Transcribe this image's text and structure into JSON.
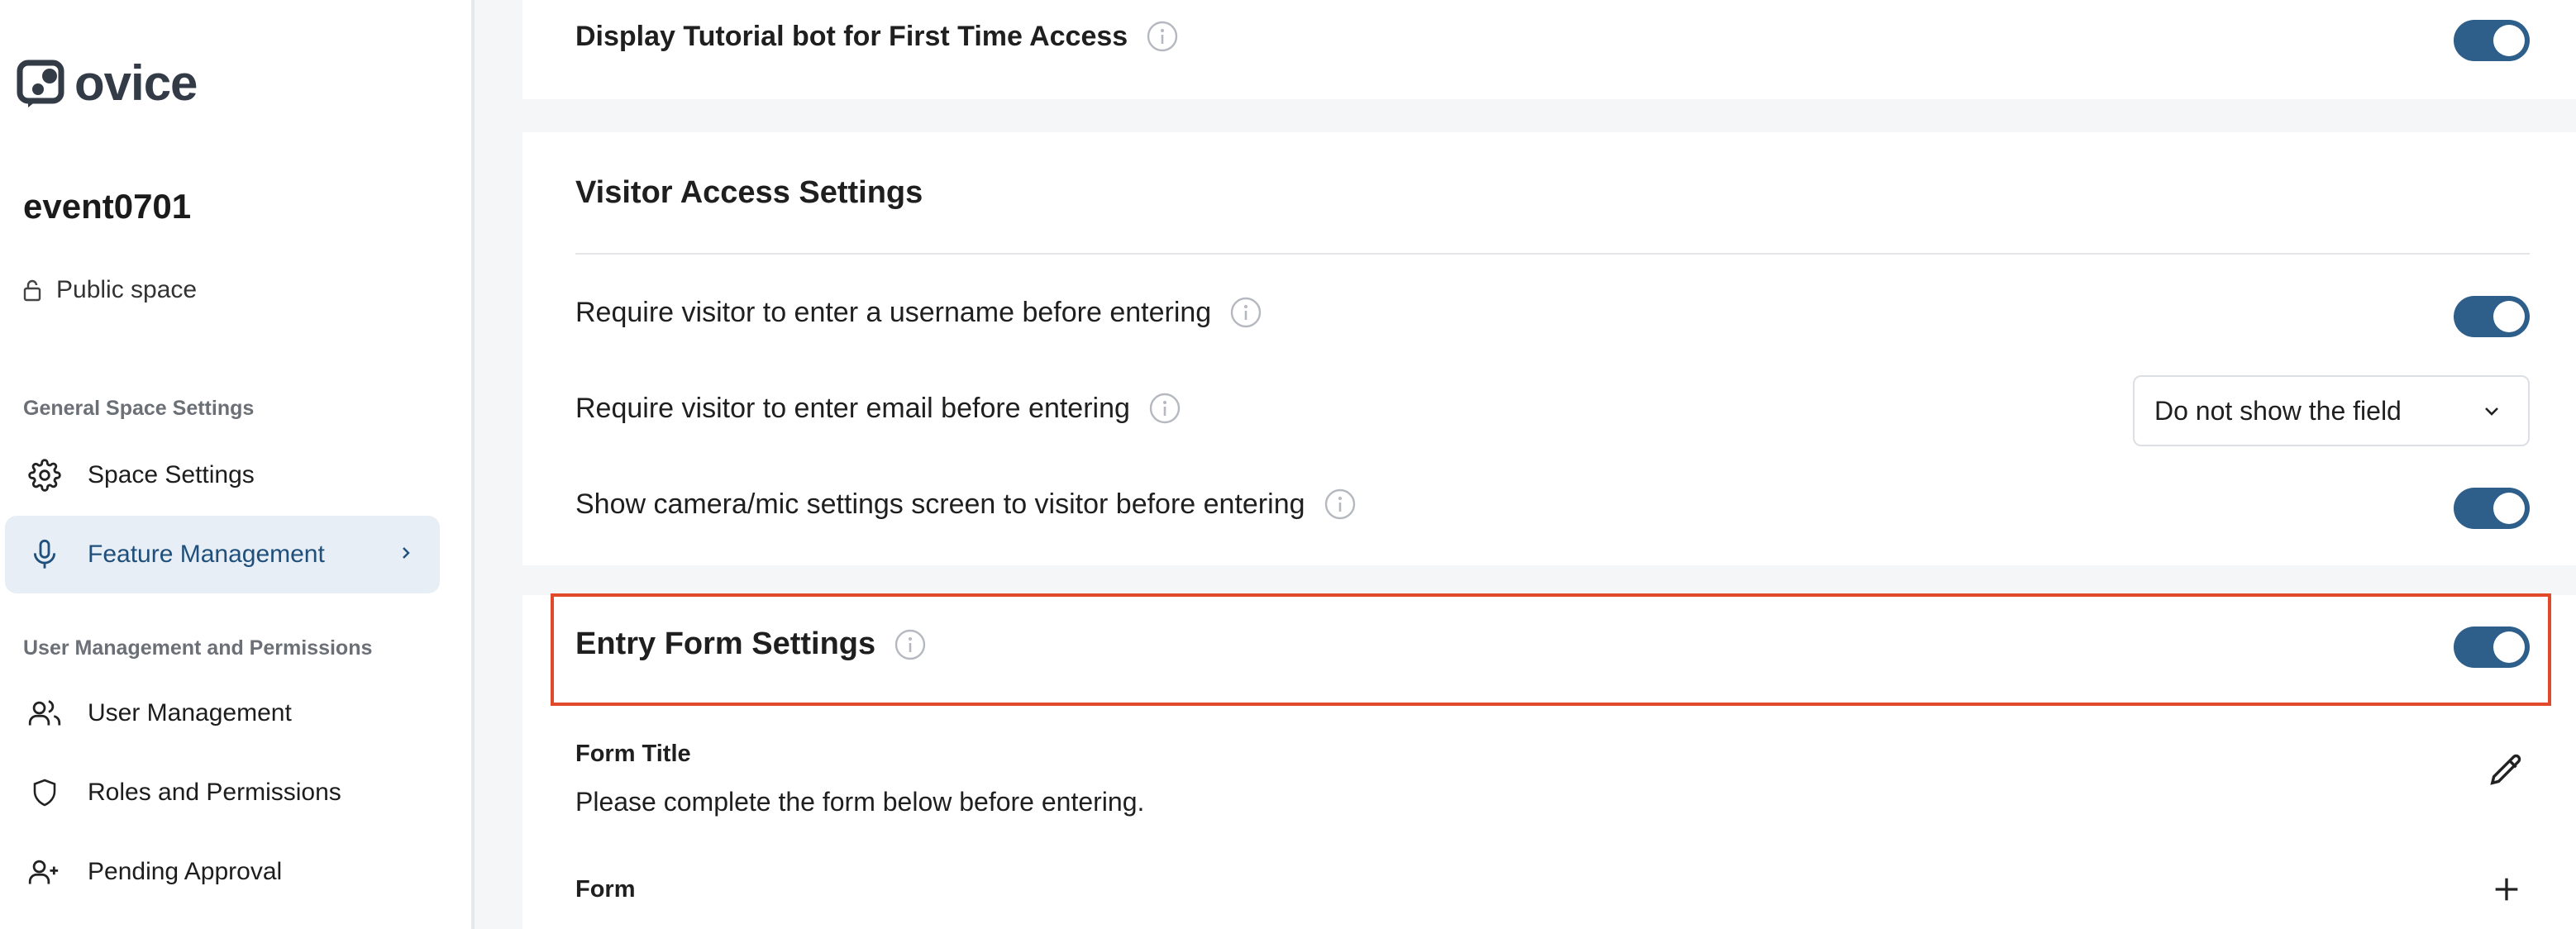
{
  "sidebar": {
    "logo_text": "ovice",
    "space_name": "event0701",
    "space_type": "Public space",
    "sections": [
      {
        "label": "General Space Settings"
      },
      {
        "label": "User Management and Permissions"
      }
    ],
    "items": [
      {
        "label": "Space Settings",
        "icon": "gear-icon"
      },
      {
        "label": "Feature Management",
        "icon": "microphone-icon",
        "active": true
      },
      {
        "label": "User Management",
        "icon": "users-icon"
      },
      {
        "label": "Roles and Permissions",
        "icon": "shield-icon"
      },
      {
        "label": "Pending Approval",
        "icon": "user-plus-icon"
      }
    ]
  },
  "main": {
    "tutorial_bot": {
      "label": "Display Tutorial bot for First Time Access",
      "enabled": true
    },
    "visitor_access": {
      "title": "Visitor Access Settings",
      "require_username": {
        "label": "Require visitor to enter a username before entering",
        "enabled": true
      },
      "require_email": {
        "label": "Require visitor to enter email before entering",
        "selected": "Do not show the field"
      },
      "camera_mic": {
        "label": "Show camera/mic settings screen to visitor before entering",
        "enabled": true
      }
    },
    "entry_form": {
      "title": "Entry Form Settings",
      "enabled": true,
      "form_title_label": "Form Title",
      "form_title_value": "Please complete the form below before entering.",
      "form_label": "Form"
    }
  },
  "colors": {
    "accent": "#2d5f8a",
    "highlight": "#e2492b",
    "active_bg": "#e7eef5"
  }
}
